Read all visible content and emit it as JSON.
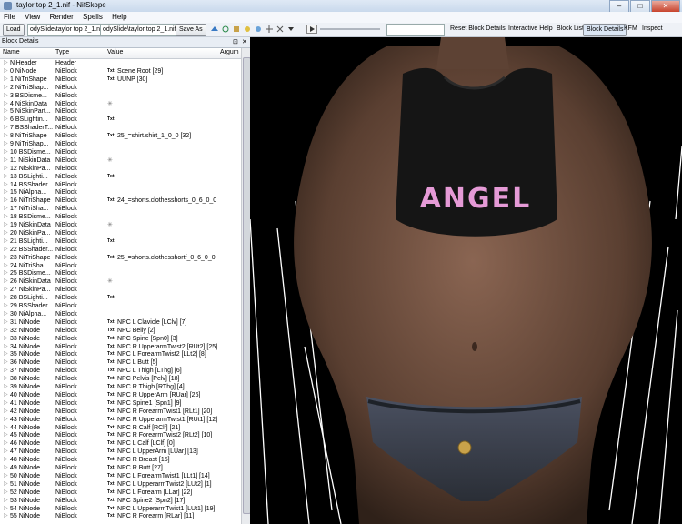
{
  "window": {
    "title": "taylor top 2_1.nif - NifSkope",
    "min": "–",
    "max": "□",
    "close": "✕"
  },
  "menu": [
    "File",
    "View",
    "Render",
    "Spells",
    "Help"
  ],
  "toolbar": {
    "load": "Load",
    "path1": "odySlide\\taylor top 2_1.nif",
    "path2": "odySlide\\taylor top 2_1.nif",
    "save_as": "Save As",
    "reset_block_details": "Reset Block Details",
    "interactive_help": "Interactive Help",
    "block_list": "Block List",
    "block_details": "Block Details",
    "kfm": "KFM",
    "inspect": "Inspect"
  },
  "panel": {
    "title": "Block Details",
    "float": "⊡",
    "close": "✕"
  },
  "columns": {
    "name": "Name",
    "type": "Type",
    "value": "Value",
    "args": "Argum"
  },
  "rows": [
    {
      "name": "NiHeader",
      "type": "Header",
      "txt": "",
      "value": "",
      "star": false
    },
    {
      "name": "0 NiNode",
      "type": "NiBlock",
      "txt": "Txt",
      "value": "Scene Root [29]",
      "star": false
    },
    {
      "name": "1 NiTriShape",
      "type": "NiBlock",
      "txt": "Txt",
      "value": "UUNP [30]",
      "star": false
    },
    {
      "name": "2 NiTriShap...",
      "type": "NiBlock",
      "txt": "",
      "value": "",
      "star": false
    },
    {
      "name": "3 BSDisme...",
      "type": "NiBlock",
      "txt": "",
      "value": "",
      "star": false
    },
    {
      "name": "4 NiSkinData",
      "type": "NiBlock",
      "txt": "",
      "value": "",
      "star": true
    },
    {
      "name": "5 NiSkinPart...",
      "type": "NiBlock",
      "txt": "",
      "value": "",
      "star": false
    },
    {
      "name": "6 BSLightin...",
      "type": "NiBlock",
      "txt": "Txt",
      "value": "",
      "star": false
    },
    {
      "name": "7 BSShaderT...",
      "type": "NiBlock",
      "txt": "",
      "value": "",
      "star": false
    },
    {
      "name": "8 NiTriShape",
      "type": "NiBlock",
      "txt": "Txt",
      "value": "25_=shirt.shirt_1_0_0 [32]",
      "star": false
    },
    {
      "name": "9 NiTriShap...",
      "type": "NiBlock",
      "txt": "",
      "value": "",
      "star": false
    },
    {
      "name": "10 BSDisme...",
      "type": "NiBlock",
      "txt": "",
      "value": "",
      "star": false
    },
    {
      "name": "11 NiSkinData",
      "type": "NiBlock",
      "txt": "",
      "value": "",
      "star": true
    },
    {
      "name": "12 NiSkinPa...",
      "type": "NiBlock",
      "txt": "",
      "value": "",
      "star": false
    },
    {
      "name": "13 BSLighti...",
      "type": "NiBlock",
      "txt": "Txt",
      "value": "",
      "star": false
    },
    {
      "name": "14 BSShader...",
      "type": "NiBlock",
      "txt": "",
      "value": "",
      "star": false
    },
    {
      "name": "15 NiAlpha...",
      "type": "NiBlock",
      "txt": "",
      "value": "",
      "star": false
    },
    {
      "name": "16 NiTriShape",
      "type": "NiBlock",
      "txt": "Txt",
      "value": "24_=shorts.clothesshorts_0_6_0_0 ...",
      "star": false
    },
    {
      "name": "17 NiTriSha...",
      "type": "NiBlock",
      "txt": "",
      "value": "",
      "star": false
    },
    {
      "name": "18 BSDisme...",
      "type": "NiBlock",
      "txt": "",
      "value": "",
      "star": false
    },
    {
      "name": "19 NiSkinData",
      "type": "NiBlock",
      "txt": "",
      "value": "",
      "star": true
    },
    {
      "name": "20 NiSkinPa...",
      "type": "NiBlock",
      "txt": "",
      "value": "",
      "star": false
    },
    {
      "name": "21 BSLighti...",
      "type": "NiBlock",
      "txt": "Txt",
      "value": "",
      "star": false
    },
    {
      "name": "22 BSShader...",
      "type": "NiBlock",
      "txt": "",
      "value": "",
      "star": false
    },
    {
      "name": "23 NiTriShape",
      "type": "NiBlock",
      "txt": "Txt",
      "value": "25_=shorts.clothesshortf_0_6_0_0 ...",
      "star": false
    },
    {
      "name": "24 NiTriSha...",
      "type": "NiBlock",
      "txt": "",
      "value": "",
      "star": false
    },
    {
      "name": "25 BSDisme...",
      "type": "NiBlock",
      "txt": "",
      "value": "",
      "star": false
    },
    {
      "name": "26 NiSkinData",
      "type": "NiBlock",
      "txt": "",
      "value": "",
      "star": true
    },
    {
      "name": "27 NiSkinPa...",
      "type": "NiBlock",
      "txt": "",
      "value": "",
      "star": false
    },
    {
      "name": "28 BSLighti...",
      "type": "NiBlock",
      "txt": "Txt",
      "value": "",
      "star": false
    },
    {
      "name": "29 BSShader...",
      "type": "NiBlock",
      "txt": "",
      "value": "",
      "star": false
    },
    {
      "name": "30 NiAlpha...",
      "type": "NiBlock",
      "txt": "",
      "value": "",
      "star": false
    },
    {
      "name": "31 NiNode",
      "type": "NiBlock",
      "txt": "Txt",
      "value": "NPC L Clavicle [LClv] [7]",
      "star": false
    },
    {
      "name": "32 NiNode",
      "type": "NiBlock",
      "txt": "Txt",
      "value": "NPC Belly [2]",
      "star": false
    },
    {
      "name": "33 NiNode",
      "type": "NiBlock",
      "txt": "Txt",
      "value": "NPC Spine [Spn0] [3]",
      "star": false
    },
    {
      "name": "34 NiNode",
      "type": "NiBlock",
      "txt": "Txt",
      "value": "NPC R UpperarmTwist2 [RUt2] [25]",
      "star": false
    },
    {
      "name": "35 NiNode",
      "type": "NiBlock",
      "txt": "Txt",
      "value": "NPC L ForearmTwist2 [LLt2] [8]",
      "star": false
    },
    {
      "name": "36 NiNode",
      "type": "NiBlock",
      "txt": "Txt",
      "value": "NPC L Butt [5]",
      "star": false
    },
    {
      "name": "37 NiNode",
      "type": "NiBlock",
      "txt": "Txt",
      "value": "NPC L Thigh [LThg] [6]",
      "star": false
    },
    {
      "name": "38 NiNode",
      "type": "NiBlock",
      "txt": "Txt",
      "value": "NPC Pelvis [Pelv] [18]",
      "star": false
    },
    {
      "name": "39 NiNode",
      "type": "NiBlock",
      "txt": "Txt",
      "value": "NPC R Thigh [RThg] [4]",
      "star": false
    },
    {
      "name": "40 NiNode",
      "type": "NiBlock",
      "txt": "Txt",
      "value": "NPC R UpperArm [RUar] [26]",
      "star": false
    },
    {
      "name": "41 NiNode",
      "type": "NiBlock",
      "txt": "Txt",
      "value": "NPC Spine1 [Spn1] [9]",
      "star": false
    },
    {
      "name": "42 NiNode",
      "type": "NiBlock",
      "txt": "Txt",
      "value": "NPC R ForearmTwist1 [RLt1] [20]",
      "star": false
    },
    {
      "name": "43 NiNode",
      "type": "NiBlock",
      "txt": "Txt",
      "value": "NPC R UpperarmTwist1 [RUt1] [12]",
      "star": false
    },
    {
      "name": "44 NiNode",
      "type": "NiBlock",
      "txt": "Txt",
      "value": "NPC R Calf [RClf] [21]",
      "star": false
    },
    {
      "name": "45 NiNode",
      "type": "NiBlock",
      "txt": "Txt",
      "value": "NPC R ForearmTwist2 [RLt2] [10]",
      "star": false
    },
    {
      "name": "46 NiNode",
      "type": "NiBlock",
      "txt": "Txt",
      "value": "NPC L Calf [LClf] [0]",
      "star": false
    },
    {
      "name": "47 NiNode",
      "type": "NiBlock",
      "txt": "Txt",
      "value": "NPC L UpperArm [LUar] [13]",
      "star": false
    },
    {
      "name": "48 NiNode",
      "type": "NiBlock",
      "txt": "Txt",
      "value": "NPC R Breast [15]",
      "star": false
    },
    {
      "name": "49 NiNode",
      "type": "NiBlock",
      "txt": "Txt",
      "value": "NPC R Butt [27]",
      "star": false
    },
    {
      "name": "50 NiNode",
      "type": "NiBlock",
      "txt": "Txt",
      "value": "NPC L ForearmTwist1 [LLt1] [14]",
      "star": false
    },
    {
      "name": "51 NiNode",
      "type": "NiBlock",
      "txt": "Txt",
      "value": "NPC L UpperarmTwist2 [LUt2] [1]",
      "star": false
    },
    {
      "name": "52 NiNode",
      "type": "NiBlock",
      "txt": "Txt",
      "value": "NPC L Forearm [LLar] [22]",
      "star": false
    },
    {
      "name": "53 NiNode",
      "type": "NiBlock",
      "txt": "Txt",
      "value": "NPC Spine2 [Spn2] [17]",
      "star": false
    },
    {
      "name": "54 NiNode",
      "type": "NiBlock",
      "txt": "Txt",
      "value": "NPC L UpperarmTwist1 [LUt1] [19]",
      "star": false
    },
    {
      "name": "55 NiNode",
      "type": "NiBlock",
      "txt": "Txt",
      "value": "NPC R Forearm [RLar] [11]",
      "star": false
    }
  ],
  "viewport": {
    "shirt_text": "ANGEL"
  },
  "colors": {
    "skin": "#6b4c3b",
    "shirt": "#151515",
    "print": "#e59ad6",
    "denim": "#3a3f48",
    "bg": "#000000"
  }
}
